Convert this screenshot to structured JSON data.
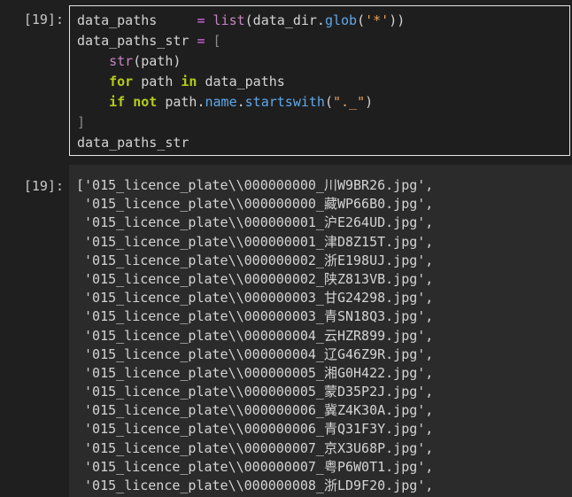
{
  "input_cell": {
    "prompt": "[19]:",
    "lines": [
      [
        {
          "text": "data_paths     ",
          "cls": "tk-var"
        },
        {
          "text": "= ",
          "cls": "tk-op"
        },
        {
          "text": "list",
          "cls": "tk-builtin"
        },
        {
          "text": "(data_dir.",
          "cls": "tk-plain"
        },
        {
          "text": "glob",
          "cls": "tk-attr"
        },
        {
          "text": "(",
          "cls": "tk-plain"
        },
        {
          "text": "'*'",
          "cls": "tk-str"
        },
        {
          "text": "))",
          "cls": "tk-plain"
        }
      ],
      [
        {
          "text": "data_paths_str ",
          "cls": "tk-var"
        },
        {
          "text": "= ",
          "cls": "tk-op"
        },
        {
          "text": "[",
          "cls": "tk-bracket"
        }
      ],
      [
        {
          "text": "    ",
          "cls": "tk-plain"
        },
        {
          "text": "str",
          "cls": "tk-builtin"
        },
        {
          "text": "(path)",
          "cls": "tk-plain"
        }
      ],
      [
        {
          "text": "    ",
          "cls": "tk-plain"
        },
        {
          "text": "for",
          "cls": "tk-kw"
        },
        {
          "text": " path ",
          "cls": "tk-plain"
        },
        {
          "text": "in",
          "cls": "tk-kw"
        },
        {
          "text": " data_paths",
          "cls": "tk-plain"
        }
      ],
      [
        {
          "text": "    ",
          "cls": "tk-plain"
        },
        {
          "text": "if",
          "cls": "tk-kw"
        },
        {
          "text": " ",
          "cls": "tk-plain"
        },
        {
          "text": "not",
          "cls": "tk-kw"
        },
        {
          "text": " path.",
          "cls": "tk-plain"
        },
        {
          "text": "name",
          "cls": "tk-attr"
        },
        {
          "text": ".",
          "cls": "tk-plain"
        },
        {
          "text": "startswith",
          "cls": "tk-attr"
        },
        {
          "text": "(",
          "cls": "tk-plain"
        },
        {
          "text": "\"._\"",
          "cls": "tk-str"
        },
        {
          "text": ")",
          "cls": "tk-plain"
        }
      ],
      [
        {
          "text": "]",
          "cls": "tk-bracket"
        }
      ],
      [
        {
          "text": "data_paths_str",
          "cls": "tk-plain"
        }
      ]
    ]
  },
  "output_cell": {
    "prompt": "[19]:",
    "lines": [
      "['015_licence_plate\\\\000000000_川W9BR26.jpg',",
      " '015_licence_plate\\\\000000000_藏WP66B0.jpg',",
      " '015_licence_plate\\\\000000001_沪E264UD.jpg',",
      " '015_licence_plate\\\\000000001_津D8Z15T.jpg',",
      " '015_licence_plate\\\\000000002_浙E198UJ.jpg',",
      " '015_licence_plate\\\\000000002_陕Z813VB.jpg',",
      " '015_licence_plate\\\\000000003_甘G24298.jpg',",
      " '015_licence_plate\\\\000000003_青SN18Q3.jpg',",
      " '015_licence_plate\\\\000000004_云HZR899.jpg',",
      " '015_licence_plate\\\\000000004_辽G46Z9R.jpg',",
      " '015_licence_plate\\\\000000005_湘G0H422.jpg',",
      " '015_licence_plate\\\\000000005_蒙D35P2J.jpg',",
      " '015_licence_plate\\\\000000006_冀Z4K30A.jpg',",
      " '015_licence_plate\\\\000000006_青Q31F3Y.jpg',",
      " '015_licence_plate\\\\000000007_京X3U68P.jpg',",
      " '015_licence_plate\\\\000000007_粤P6W0T1.jpg',",
      " '015_licence_plate\\\\000000008_浙LD9F20.jpg',"
    ]
  }
}
